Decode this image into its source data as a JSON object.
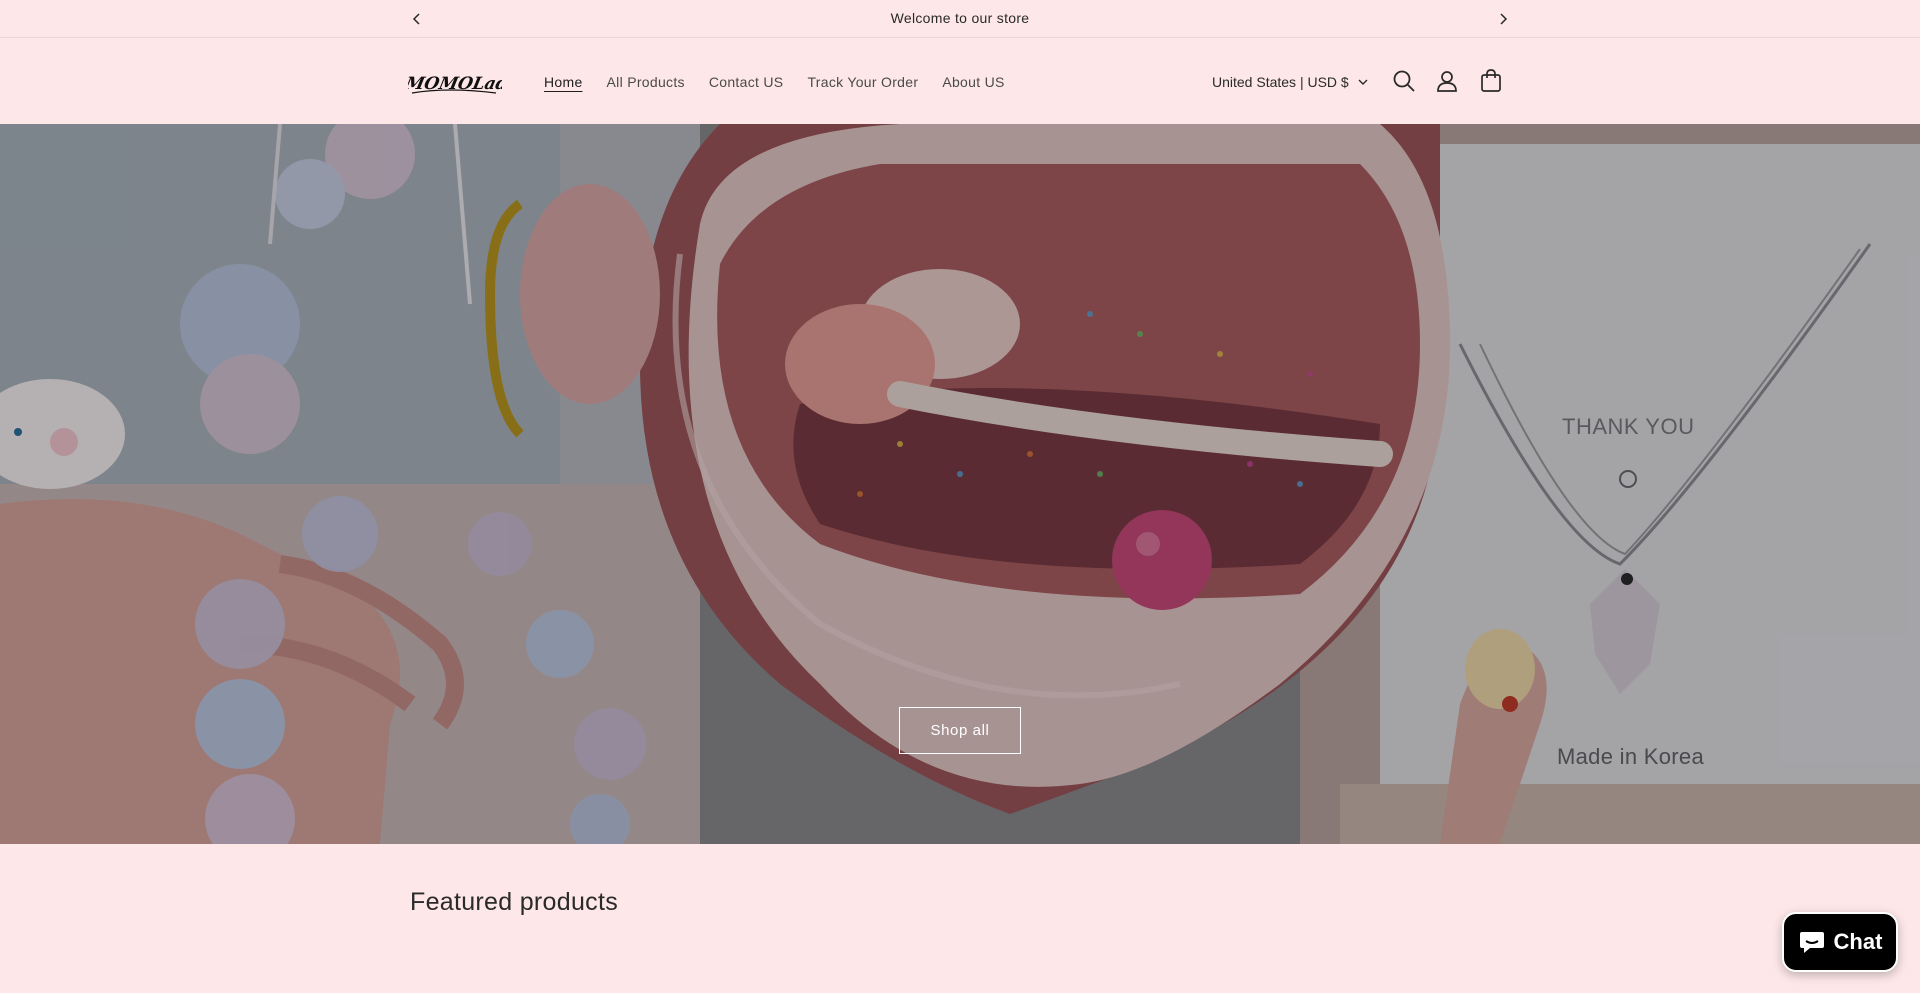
{
  "announcement": {
    "text": "Welcome to our store",
    "prev_icon": "chevron-left-icon",
    "next_icon": "chevron-right-icon"
  },
  "header": {
    "logo_text": "MOMOLady",
    "nav": [
      {
        "label": "Home",
        "active": true
      },
      {
        "label": "All Products",
        "active": false
      },
      {
        "label": "Contact US",
        "active": false
      },
      {
        "label": "Track Your Order",
        "active": false
      },
      {
        "label": "About US",
        "active": false
      }
    ],
    "locale": "United States | USD $",
    "icons": [
      "search-icon",
      "account-icon",
      "cart-icon"
    ]
  },
  "hero": {
    "card_text_1": "THANK YOU",
    "card_text_2": "Made in Korea",
    "button_label": "Shop all"
  },
  "featured": {
    "title": "Featured products"
  },
  "chat": {
    "label": "Chat",
    "icon": "chat-bubble-icon",
    "background": "#000000"
  },
  "colors": {
    "page_background": "#fde7e8",
    "text": "#2a2a2a"
  }
}
